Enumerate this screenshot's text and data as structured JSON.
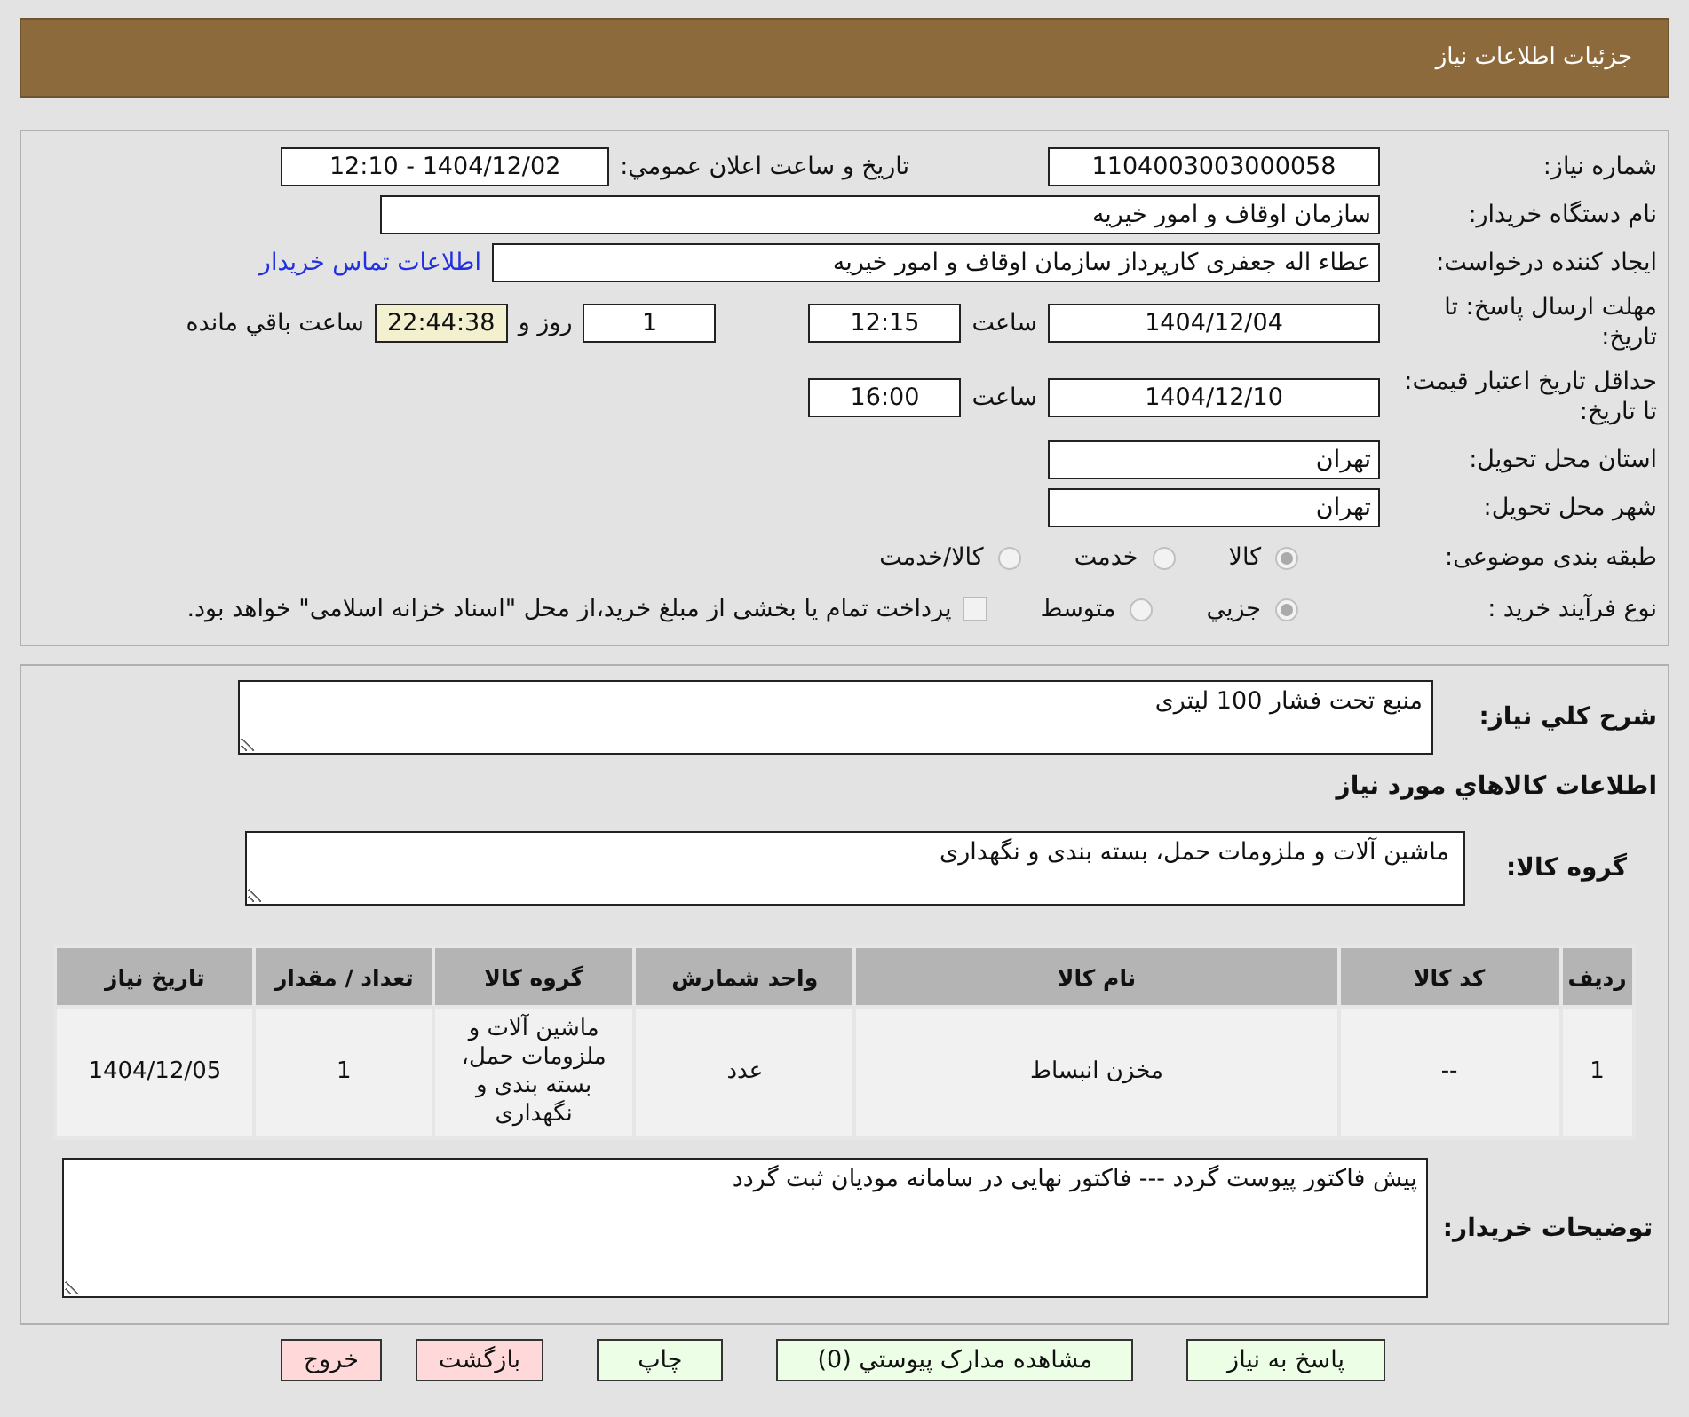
{
  "header": {
    "title": "جزئیات اطلاعات نیاز"
  },
  "details": {
    "need_number": {
      "label": "شماره نیاز:",
      "value": "1104003003000058"
    },
    "announce": {
      "label": "تاريخ و ساعت اعلان عمومي:",
      "value": "1404/12/02 - 12:10"
    },
    "buyer_org": {
      "label": "نام دستگاه خریدار:",
      "value": "سازمان اوقاف و امور خیریه"
    },
    "requester": {
      "label": "ایجاد کننده درخواست:",
      "value": "عطاء اله جعفری کارپرداز سازمان اوقاف و امور خیریه",
      "link": "اطلاعات تماس خریدار"
    },
    "deadline": {
      "label": "مهلت ارسال پاسخ: تا تاریخ:",
      "date": "1404/12/04",
      "time_label": "ساعت",
      "time": "12:15",
      "days": "1",
      "days_label": "روز و",
      "remaining": "22:44:38",
      "remaining_label": "ساعت باقي مانده"
    },
    "validity": {
      "label": "حداقل تاریخ اعتبار قیمت: تا تاریخ:",
      "date": "1404/12/10",
      "time_label": "ساعت",
      "time": "16:00"
    },
    "province": {
      "label": "استان محل تحویل:",
      "value": "تهران"
    },
    "city": {
      "label": "شهر محل تحویل:",
      "value": "تهران"
    },
    "category": {
      "label": "طبقه بندی موضوعی:",
      "options": [
        {
          "label": "کالا",
          "selected": true
        },
        {
          "label": "خدمت",
          "selected": false
        },
        {
          "label": "کالا/خدمت",
          "selected": false
        }
      ]
    },
    "process": {
      "label": "نوع فرآیند خرید :",
      "options": [
        {
          "label": "جزيي",
          "selected": true
        },
        {
          "label": "متوسط",
          "selected": false
        }
      ],
      "treasury": {
        "label": "پرداخت تمام یا بخشی از مبلغ خرید،از محل \"اسناد خزانه اسلامی\" خواهد بود.",
        "checked": false
      }
    }
  },
  "description": {
    "label": "شرح کلي نیاز:",
    "value": "منبع تحت فشار 100 لیتری"
  },
  "goods_heading": "اطلاعات کالاهاي مورد نیاز",
  "goods_group": {
    "label": "گروه کالا:",
    "value": "ماشین آلات و ملزومات حمل، بسته بندی و نگهداری"
  },
  "table": {
    "columns": [
      "ردیف",
      "کد کالا",
      "نام کالا",
      "واحد شمارش",
      "گروه کالا",
      "تعداد / مقدار",
      "تاریخ نیاز"
    ],
    "rows": [
      [
        "1",
        "--",
        "مخزن انبساط",
        "عدد",
        "ماشین آلات و ملزومات حمل، بسته بندی و نگهداری",
        "1",
        "1404/12/05"
      ]
    ]
  },
  "buyer_notes": {
    "label": "توضیحات خریدار:",
    "value": "پیش فاکتور پیوست گردد --- فاکتور نهایی در سامانه مودیان ثبت گردد"
  },
  "buttons": [
    {
      "label": "پاسخ به نیاز",
      "kind": "action"
    },
    {
      "label": "مشاهده مدارک پیوستي (0)",
      "kind": "action"
    },
    {
      "label": "چاپ",
      "kind": "action"
    },
    {
      "label": "بازگشت",
      "kind": "exit"
    },
    {
      "label": "خروج",
      "kind": "exit"
    }
  ]
}
